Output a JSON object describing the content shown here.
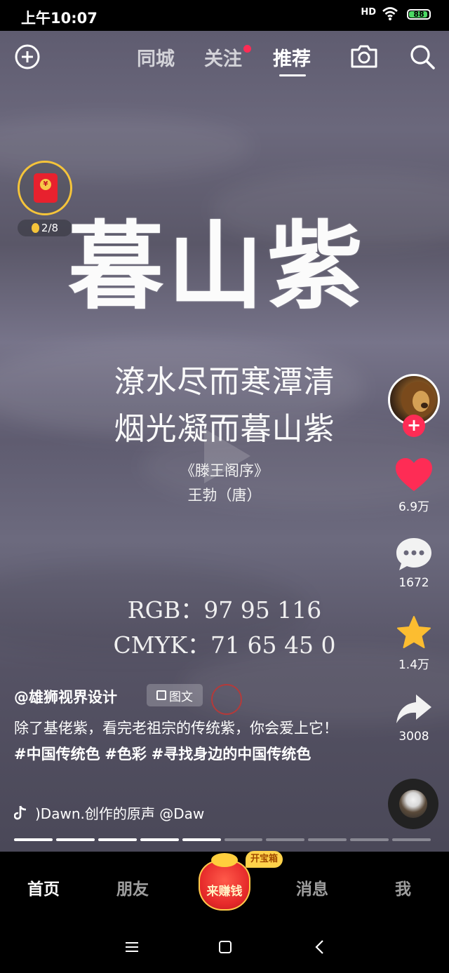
{
  "status_bar": {
    "time": "上午10:07",
    "signal": "HD",
    "battery": "88"
  },
  "top_nav": {
    "tabs": [
      {
        "label": "同城",
        "active": false
      },
      {
        "label": "关注",
        "active": false,
        "dot": true
      },
      {
        "label": "推荐",
        "active": true
      }
    ]
  },
  "coin_widget": {
    "progress": "2/8",
    "packet_symbol": "¥"
  },
  "video": {
    "title": "暮山紫",
    "poem_line1": "潦水尽而寒潭清",
    "poem_line2": "烟光凝而暮山紫",
    "source_work": "《滕王阁序》",
    "source_author": "王勃（唐）",
    "rgb": "RGB：97 95 116",
    "cmyk": "CMYK：71 65 45 0",
    "bg_color": "#615f74"
  },
  "side_actions": {
    "likes": "6.9万",
    "comments": "1672",
    "favorites": "1.4万",
    "shares": "3008"
  },
  "post": {
    "author": "@雄狮视界设计",
    "tag": "图文",
    "description_plain": "除了基佬紫，看完老祖宗的传统紫，你会爱上它！",
    "hashtags": [
      "#中国传统色",
      "#色彩",
      "#寻找身边的中国传统色"
    ],
    "music": ")Dawn.创作的原声    @Daw"
  },
  "progress": {
    "total": 10,
    "done": 5
  },
  "bottom_tabs": [
    {
      "label": "首页",
      "active": true
    },
    {
      "label": "朋友",
      "active": false
    },
    {
      "label": "消息",
      "active": false
    },
    {
      "label": "我",
      "active": false
    }
  ],
  "earn_button": {
    "label": "来赚钱",
    "badge": "开宝箱"
  },
  "colors": {
    "accent_red": "#fe2c55",
    "like_red": "#fe2c55",
    "star_yellow": "#fcbd30",
    "coin_gold": "#f5c43a"
  }
}
